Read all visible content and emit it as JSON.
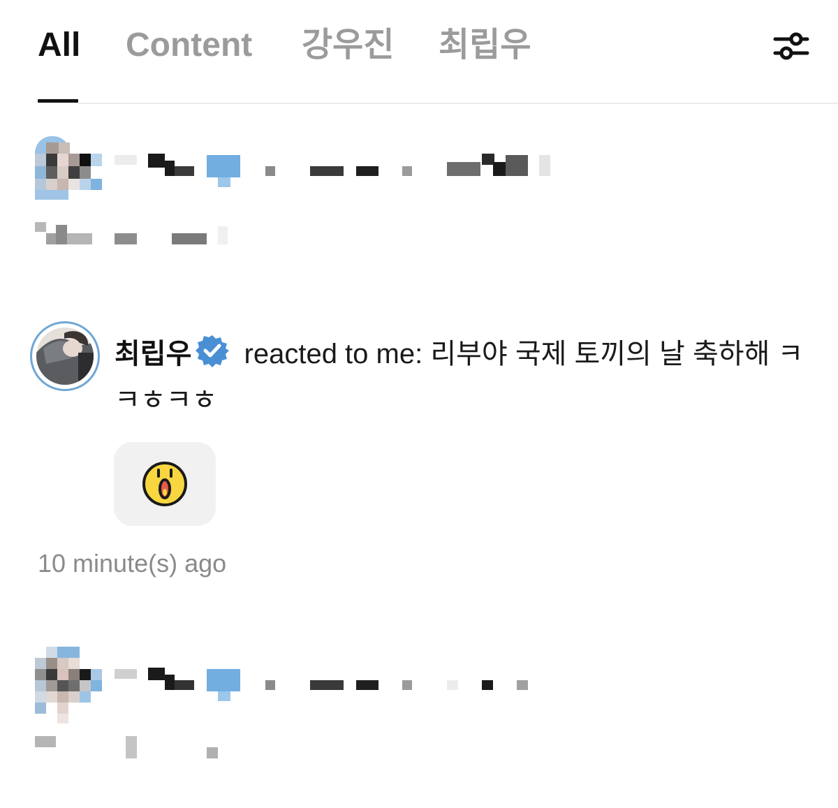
{
  "tabs": {
    "items": [
      {
        "label": "All"
      },
      {
        "label": "Content"
      },
      {
        "label": "강우진"
      },
      {
        "label": "최립우"
      }
    ],
    "active": "All",
    "filter_icon": "sliders-icon"
  },
  "notification": {
    "sender_name": "최립우",
    "message": " reacted to me: 리부야 국제 토끼의 날 축하해 ㅋㅋㅎㅋㅎ",
    "verified_icon": "verified-check-icon",
    "reaction_icon": "surprised-face-emoji-icon",
    "timestamp": "10 minute(s) ago",
    "avatar_ring_color": "#6ea6d6",
    "verified_color": "#4a8fd4",
    "reaction_color": "#f7d640"
  }
}
